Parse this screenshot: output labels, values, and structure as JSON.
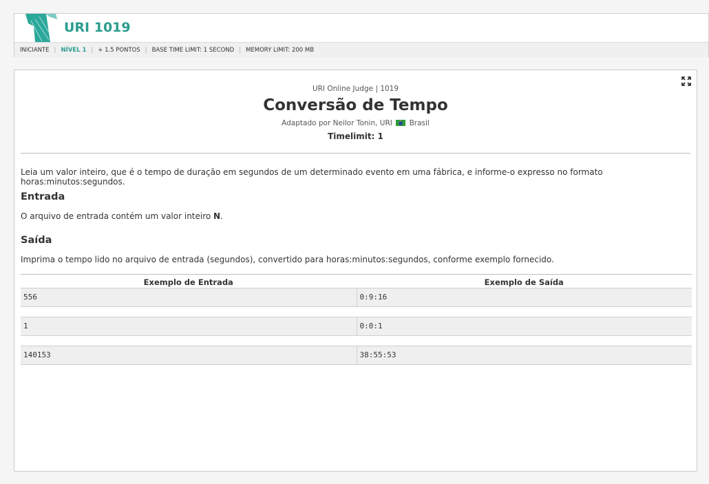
{
  "header": {
    "problem_title": "URI 1019",
    "meta": {
      "category": "INICIANTE",
      "level": "NÍVEL 1",
      "points": "+ 1.5 PONTOS",
      "time_limit": "BASE TIME LIMIT: 1 SECOND",
      "memory_limit": "MEMORY LIMIT: 200 MB"
    }
  },
  "problem": {
    "judge_line": "URI Online Judge | 1019",
    "title": "Conversão de Tempo",
    "author_prefix": "Adaptado por Neilor Tonin, URI",
    "country": "Brasil",
    "timelimit": "Timelimit: 1",
    "description": "Leia um valor inteiro, que é o tempo de duração em segundos de um determinado evento em uma fábrica, e informe-o expresso no formato horas:minutos:segundos.",
    "input_heading": "Entrada",
    "input_text_prefix": "O arquivo de entrada contém um valor inteiro ",
    "input_text_var": "N",
    "input_text_suffix": ".",
    "output_heading": "Saída",
    "output_text": "Imprima o tempo lido no arquivo de entrada (segundos), convertido para horas:minutos:segundos, conforme exemplo fornecido.",
    "samples": {
      "input_header": "Exemplo de Entrada",
      "output_header": "Exemplo de Saída",
      "rows": [
        {
          "input": "556",
          "output": "0:9:16"
        },
        {
          "input": "1",
          "output": "0:0:1"
        },
        {
          "input": "140153",
          "output": "38:55:53"
        }
      ]
    }
  },
  "icons": {
    "logo": "uri-logo-icon",
    "expand": "expand-fullscreen-icon",
    "flag": "brazil-flag-icon"
  },
  "colors": {
    "accent": "#2a9d8f",
    "sample_bg": "#efefef"
  }
}
